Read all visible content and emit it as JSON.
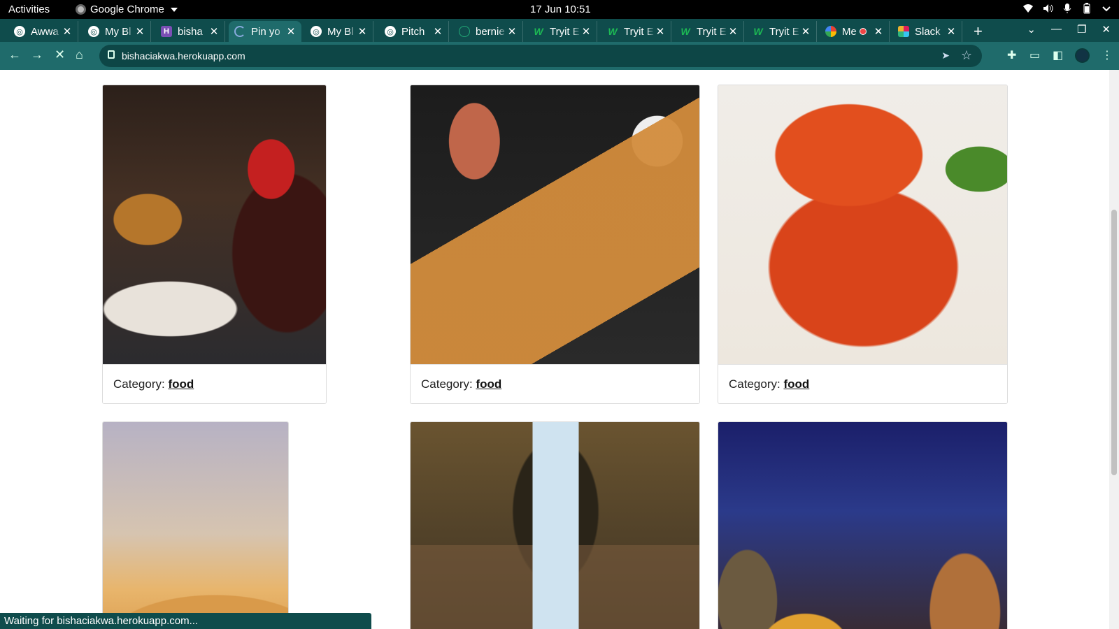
{
  "os": {
    "activities": "Activities",
    "app_name": "Google Chrome",
    "clock": "17 Jun  10:51"
  },
  "tabs": [
    {
      "title": "Awwa",
      "icon": "globe-icon"
    },
    {
      "title": "My Bl",
      "icon": "globe-icon"
    },
    {
      "title": "bisha",
      "icon": "heroku-icon"
    },
    {
      "title": "Pin yo",
      "icon": "loading-icon",
      "active": true
    },
    {
      "title": "My Bl",
      "icon": "globe-icon"
    },
    {
      "title": "Pitch",
      "icon": "globe-icon"
    },
    {
      "title": "bernie",
      "icon": "github-icon"
    },
    {
      "title": "Tryit E",
      "icon": "w3schools-icon"
    },
    {
      "title": "Tryit E",
      "icon": "w3schools-icon"
    },
    {
      "title": "Tryit E",
      "icon": "w3schools-icon"
    },
    {
      "title": "Tryit E",
      "icon": "w3schools-icon"
    },
    {
      "title": "Me",
      "icon": "meet-icon"
    },
    {
      "title": "Slack",
      "icon": "slack-icon"
    }
  ],
  "address_bar": {
    "url": "bishaciakwa.herokuapp.com"
  },
  "cards": [
    {
      "category_label": "Category:",
      "category": "food",
      "image": "burger and coca-cola"
    },
    {
      "category_label": "Category:",
      "category": "food",
      "image": "sushi platter"
    },
    {
      "category_label": "Category:",
      "category": "food",
      "image": "crab dish"
    },
    {
      "image": "desert dunes"
    },
    {
      "image": "tent beach view"
    },
    {
      "image": "town at night"
    }
  ],
  "status_text": "Waiting for bishaciakwa.herokuapp.com...",
  "colors": {
    "tab_strip": "#0f4c4c",
    "toolbar": "#1f6b6b"
  }
}
